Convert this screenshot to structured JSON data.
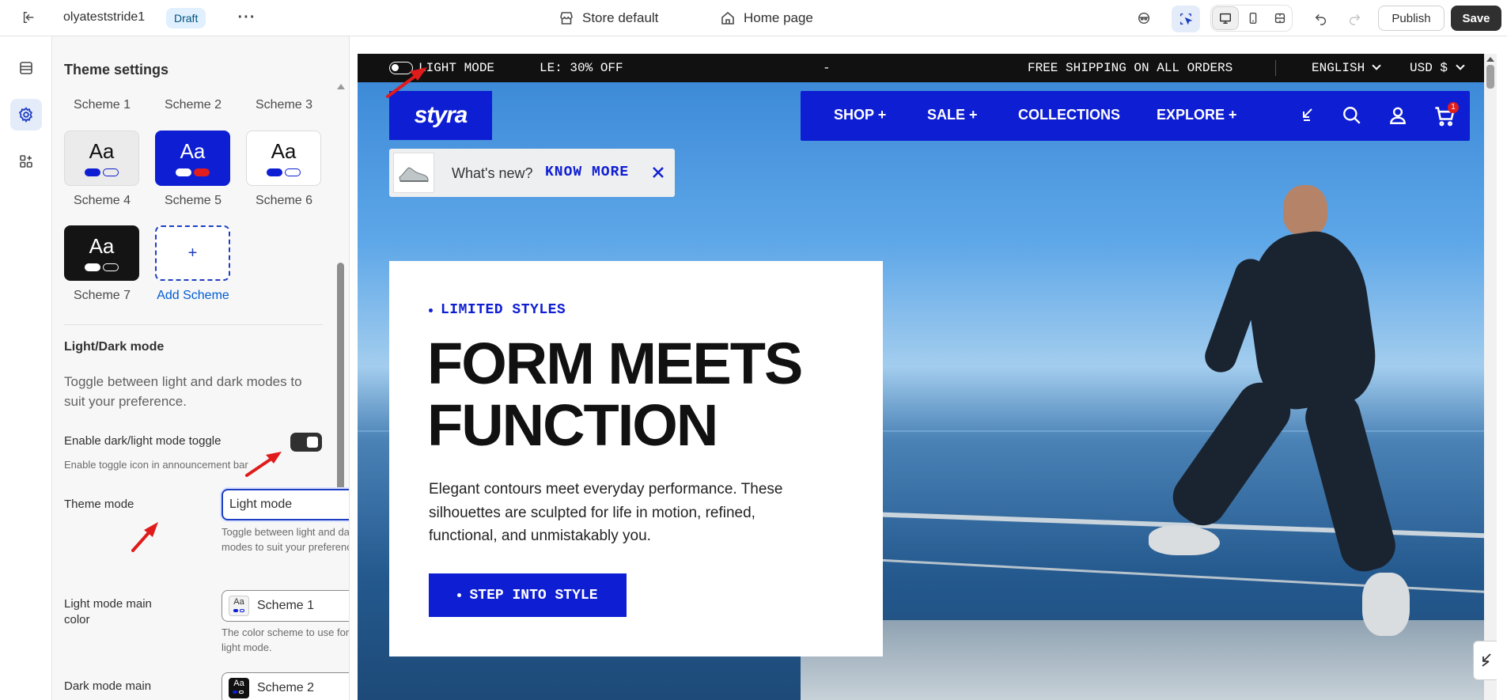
{
  "topbar": {
    "store_name": "olyateststride1",
    "status_badge": "Draft",
    "theme_selector": "Store default",
    "page_selector": "Home page",
    "publish_label": "Publish",
    "save_label": "Save"
  },
  "panel": {
    "title": "Theme settings",
    "schemes": [
      {
        "label": "Scheme 1"
      },
      {
        "label": "Scheme 2"
      },
      {
        "label": "Scheme 3"
      },
      {
        "label": "Scheme 4",
        "aa": "Aa"
      },
      {
        "label": "Scheme 5",
        "aa": "Aa"
      },
      {
        "label": "Scheme 6",
        "aa": "Aa"
      },
      {
        "label": "Scheme 7",
        "aa": "Aa"
      }
    ],
    "add_scheme_symbol": "+",
    "add_scheme_label": "Add Scheme",
    "section_title": "Light/Dark mode",
    "section_desc": "Toggle between light and dark modes to suit your preference.",
    "toggle": {
      "label": "Enable dark/light mode toggle",
      "hint": "Enable toggle icon in announcement bar",
      "enabled": true
    },
    "theme_mode": {
      "label": "Theme mode",
      "value": "Light mode",
      "hint": "Toggle between light and dark modes to suit your preference."
    },
    "light_main": {
      "label": "Light mode main color",
      "value": "Scheme 1",
      "hint": "The color scheme to use for the light mode.",
      "icon_text": "Aa"
    },
    "dark_main": {
      "label": "Dark mode main",
      "value": "Scheme 2",
      "icon_text": "Aa"
    }
  },
  "preview": {
    "announcement": {
      "mode_label": "LIGHT MODE",
      "sale_text": "LE: 30% OFF",
      "separator": "-",
      "shipping": "FREE SHIPPING ON ALL ORDERS",
      "language": "ENGLISH",
      "currency": "USD $"
    },
    "logo": "styra",
    "nav": [
      {
        "label": "SHOP +"
      },
      {
        "label": "SALE +"
      },
      {
        "label": "COLLECTIONS"
      },
      {
        "label": "EXPLORE +"
      }
    ],
    "cart_count": "1",
    "whats_new": {
      "text": "What's new?",
      "link": "KNOW MORE"
    },
    "hero": {
      "eyebrow": "LIMITED STYLES",
      "heading_line1": "FORM MEETS",
      "heading_line2": "FUNCTION",
      "body_line1": "Elegant contours meet everyday performance. These",
      "body_line2": "silhouettes are sculpted for life in motion, refined,",
      "body_line3": "functional, and unmistakably you.",
      "cta": "STEP INTO STYLE"
    }
  },
  "colors": {
    "accent_blue": "#0e1ed2",
    "link_blue": "#005bd3",
    "annotation_red": "#e01b1b"
  }
}
